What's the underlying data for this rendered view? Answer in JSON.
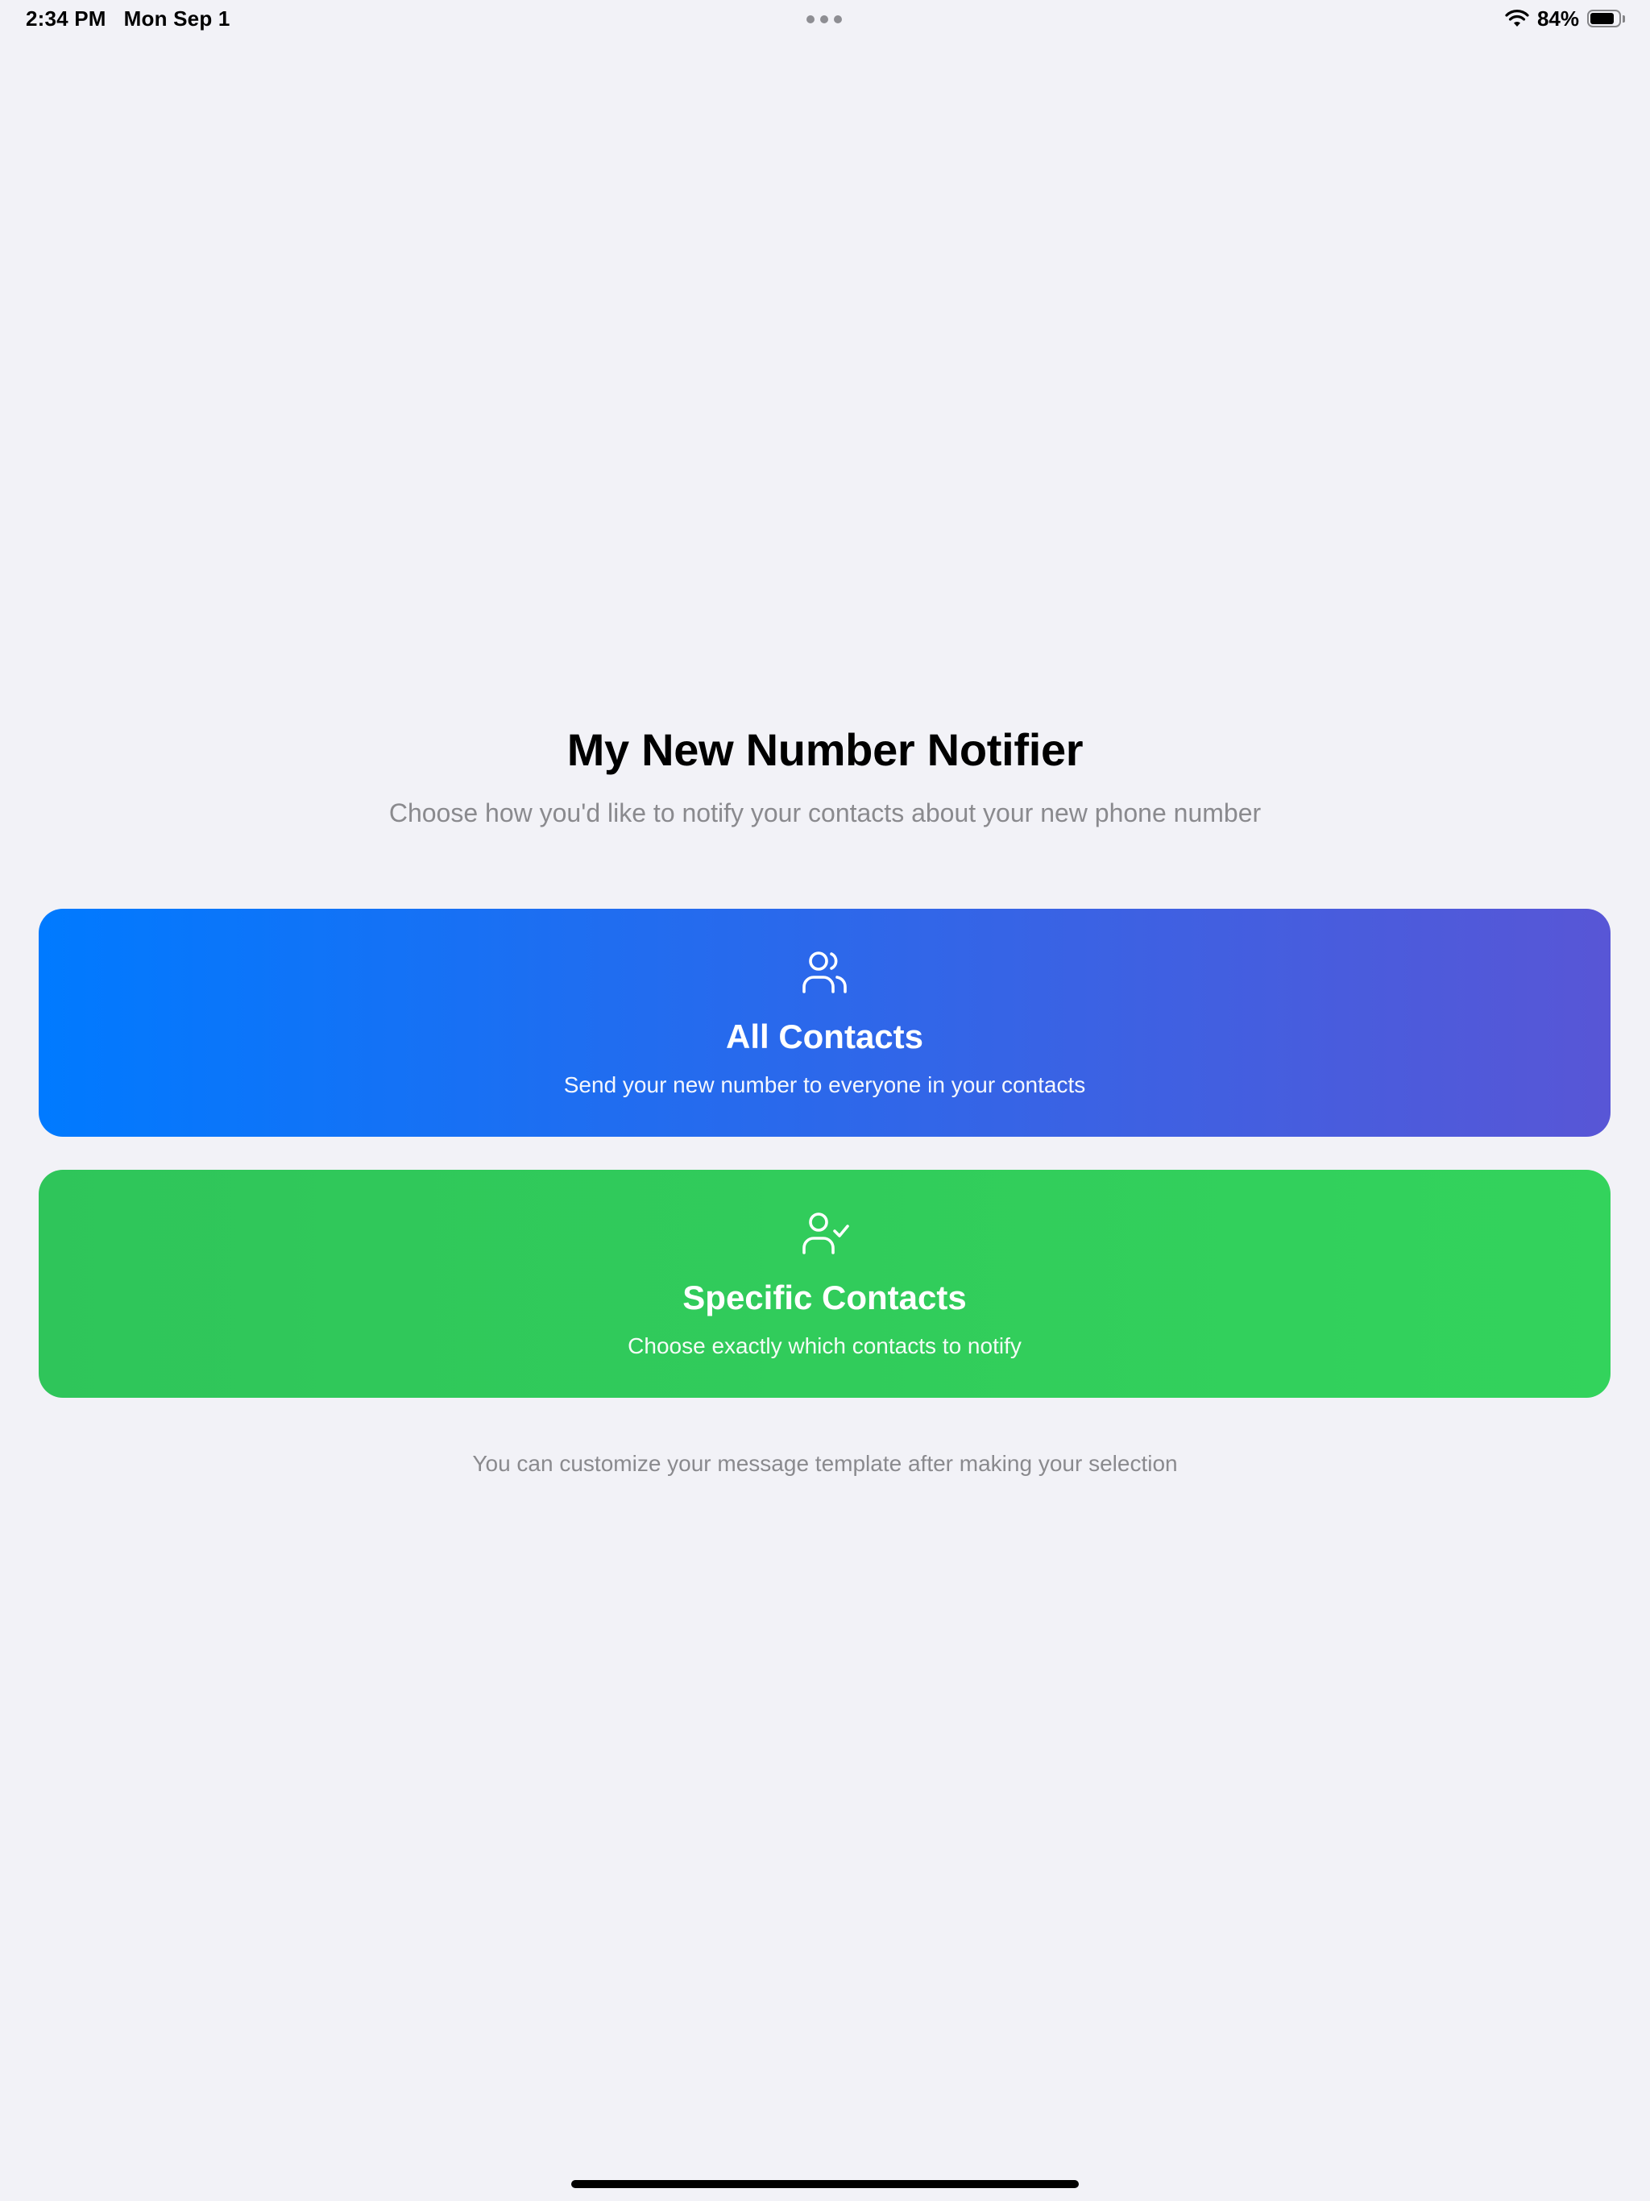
{
  "status_bar": {
    "time": "2:34 PM",
    "date": "Mon Sep 1",
    "battery_percent": "84%",
    "battery_level": 0.84,
    "icons": [
      "multitasking-dots-icon",
      "wifi-icon",
      "battery-icon"
    ]
  },
  "header": {
    "title": "My New Number Notifier",
    "subtitle": "Choose how you'd like to notify your contacts about your new phone number"
  },
  "options": [
    {
      "icon": "two-people-icon",
      "title": "All Contacts",
      "description": "Send your new number to everyone in your contacts",
      "gradient": [
        "#007AFF",
        "#5856D6"
      ]
    },
    {
      "icon": "person-checkmark-icon",
      "title": "Specific Contacts",
      "description": "Choose exactly which contacts to notify",
      "gradient": [
        "#2FC55A",
        "#33D35C"
      ]
    }
  ],
  "footnote": "You can customize your message template after making your selection",
  "colors": {
    "background": "#F2F2F7",
    "secondary_text": "#8A8A8E"
  }
}
